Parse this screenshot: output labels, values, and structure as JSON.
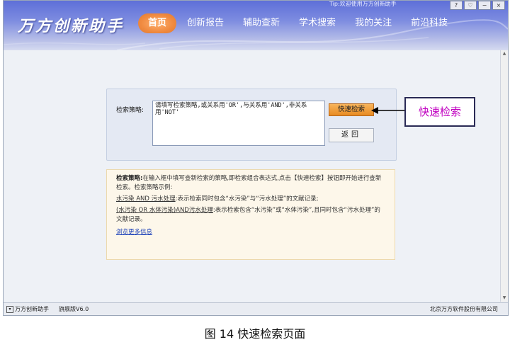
{
  "header": {
    "logo": "万方创新助手",
    "top_strip_text": "Tip:欢迎使用万方创新助手",
    "nav": [
      {
        "label": "首页",
        "active": true
      },
      {
        "label": "创新报告",
        "active": false
      },
      {
        "label": "辅助查新",
        "active": false
      },
      {
        "label": "学术搜索",
        "active": false
      },
      {
        "label": "我的关注",
        "active": false
      },
      {
        "label": "前沿科技",
        "active": false
      }
    ],
    "window_buttons": [
      "?",
      "♡",
      "−",
      "×"
    ]
  },
  "search": {
    "label": "检索策略:",
    "input_value": "请填写检索策略,或关系用'OR',与关系用'AND',非关系用'NOT'",
    "quick_button": "快速检索",
    "back_button": "返回"
  },
  "info": {
    "intro_title": "检索策略:",
    "intro_text": "在输入框中填写查新检索的策略,即检索组合表达式,点击【快速检索】按钮即开始进行查新检索。检索策略示例:",
    "example1_query": "水污染 AND 污水处理",
    "example1_text": ":表示检索同时包含“水污染”与“污水处理”的文献记录;",
    "example2_query": "(水污染 OR 水体污染)AND污水处理",
    "example2_text": ":表示检索包含“水污染”或“水体污染”,且同时包含“污水处理”的文献记录。",
    "more_link": "浏览更多信息"
  },
  "statusbar": {
    "app_name": "万方创新助手",
    "version": "旗舰版V6.0",
    "company": "北京万方软件股份有限公司"
  },
  "callout": {
    "text": "快速检索"
  },
  "caption": "图 14 快速检索页面",
  "colors": {
    "header_top": "#5e6fd8",
    "active_nav": "#f08a40",
    "callout_text": "#c000c0",
    "link": "#1a3fb8"
  }
}
